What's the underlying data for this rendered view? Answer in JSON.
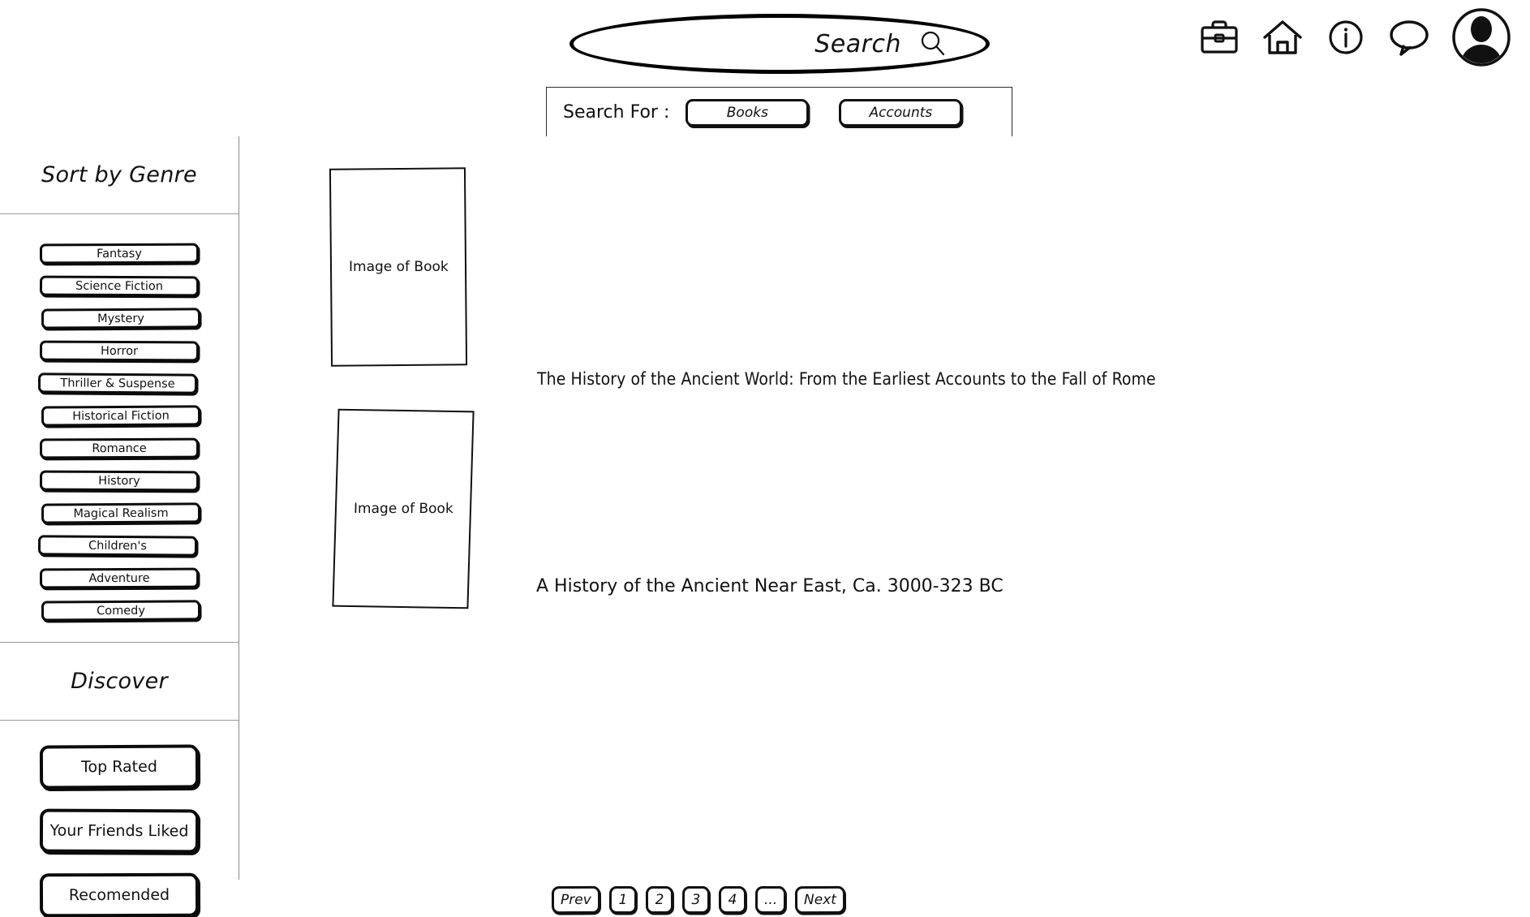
{
  "header": {
    "search": {
      "label": "Search",
      "placeholder": "Search",
      "value": "",
      "icon": "magnifier-icon"
    },
    "search_for": {
      "label": "Search For :",
      "options": [
        {
          "label": "Books",
          "name": "books"
        },
        {
          "label": "Accounts",
          "name": "accounts"
        }
      ]
    },
    "nav_icons": [
      {
        "name": "briefcase-icon",
        "label": "Briefcase"
      },
      {
        "name": "home-icon",
        "label": "Home"
      },
      {
        "name": "info-icon",
        "label": "Info"
      },
      {
        "name": "chat-bubble-icon",
        "label": "Messages"
      },
      {
        "name": "avatar-icon",
        "label": "Profile"
      }
    ]
  },
  "sidebar": {
    "genre_section": {
      "title": "Sort by Genre",
      "items": [
        {
          "label": "Fantasy"
        },
        {
          "label": "Science Fiction"
        },
        {
          "label": "Mystery"
        },
        {
          "label": "Horror"
        },
        {
          "label": "Thriller & Suspense"
        },
        {
          "label": "Historical Fiction"
        },
        {
          "label": "Romance"
        },
        {
          "label": "History"
        },
        {
          "label": "Magical Realism"
        },
        {
          "label": "Children's"
        },
        {
          "label": "Adventure"
        },
        {
          "label": "Comedy"
        }
      ]
    },
    "discover_section": {
      "title": "Discover",
      "items": [
        {
          "label": "Top Rated"
        },
        {
          "label": "Your Friends Liked"
        },
        {
          "label": "Recomended"
        }
      ]
    }
  },
  "main": {
    "results": [
      {
        "thumb_label": "Image of Book",
        "title": "The History of the Ancient World:  From the Earliest Accounts to the Fall of Rome"
      },
      {
        "thumb_label": "Image of Book",
        "title": "A History of the Ancient Near East, Ca. 3000-323 BC"
      }
    ],
    "pagination": {
      "prev_label": "Prev",
      "pages": [
        "1",
        "2",
        "3",
        "4"
      ],
      "ellipsis": "...",
      "next_label": "Next"
    }
  },
  "colors": {
    "ink": "#111111",
    "divider": "#9a9a9a",
    "paper": "#ffffff"
  }
}
